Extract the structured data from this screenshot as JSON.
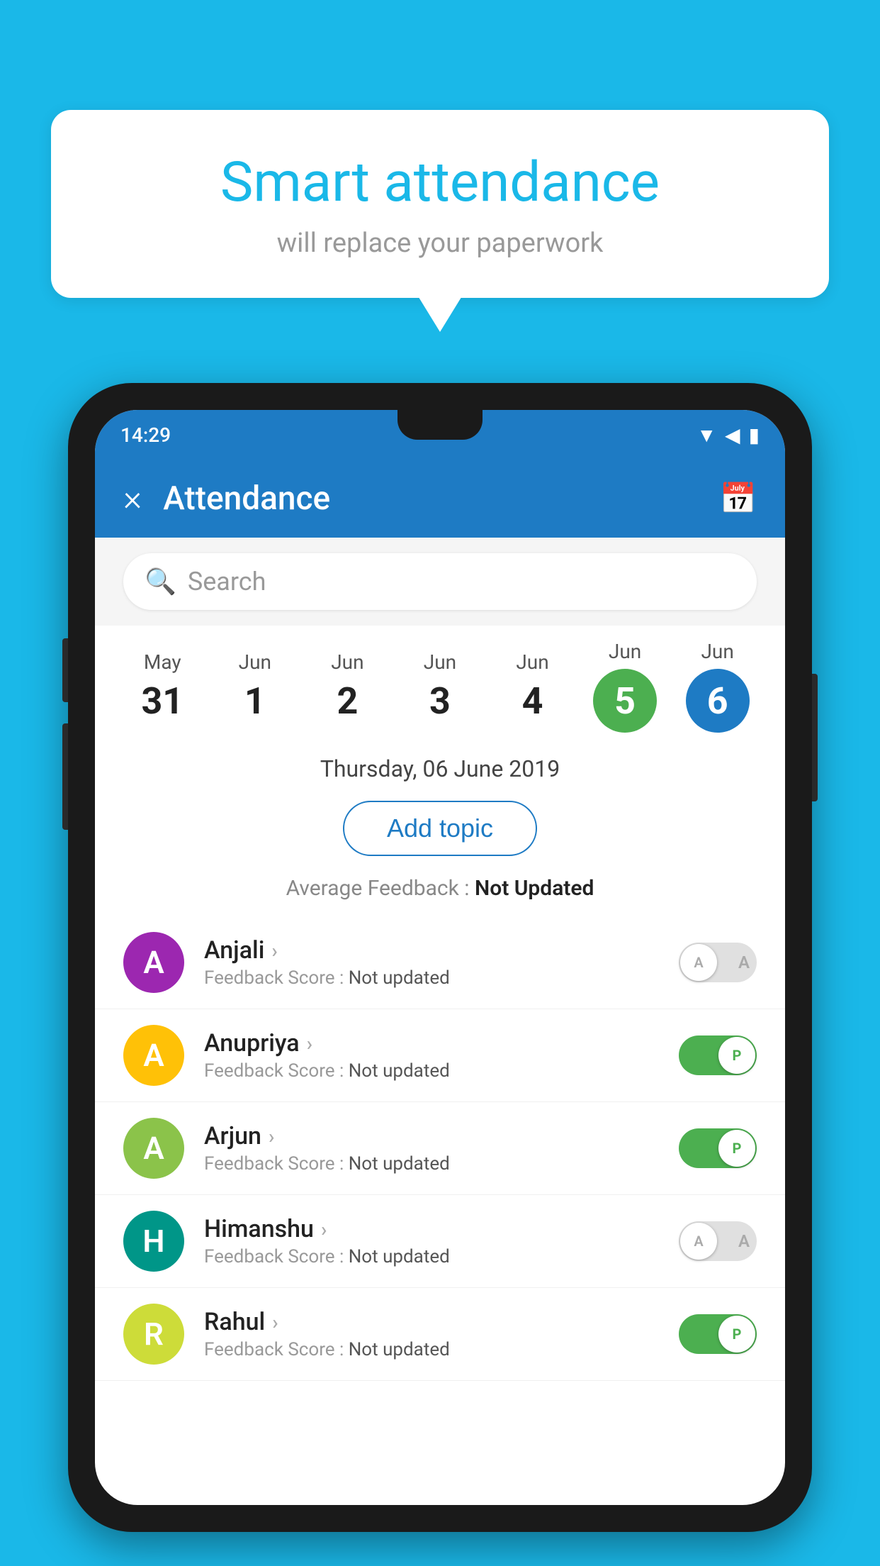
{
  "background_color": "#1ab8e8",
  "speech_bubble": {
    "title": "Smart attendance",
    "subtitle": "will replace your paperwork"
  },
  "status_bar": {
    "time": "14:29",
    "icons": [
      "wifi",
      "signal",
      "battery"
    ]
  },
  "app_bar": {
    "close_label": "×",
    "title": "Attendance",
    "calendar_icon": "📅"
  },
  "search": {
    "placeholder": "Search"
  },
  "calendar": {
    "days": [
      {
        "month": "May",
        "date": "31",
        "selected": false
      },
      {
        "month": "Jun",
        "date": "1",
        "selected": false
      },
      {
        "month": "Jun",
        "date": "2",
        "selected": false
      },
      {
        "month": "Jun",
        "date": "3",
        "selected": false
      },
      {
        "month": "Jun",
        "date": "4",
        "selected": false
      },
      {
        "month": "Jun",
        "date": "5",
        "selected": "green"
      },
      {
        "month": "Jun",
        "date": "6",
        "selected": "blue"
      }
    ]
  },
  "selected_date": "Thursday, 06 June 2019",
  "add_topic_label": "Add topic",
  "avg_feedback": {
    "label": "Average Feedback : ",
    "value": "Not Updated"
  },
  "students": [
    {
      "name": "Anjali",
      "avatar_letter": "A",
      "avatar_color": "purple",
      "feedback_label": "Feedback Score : ",
      "feedback_value": "Not updated",
      "toggle": "off",
      "toggle_letter": "A"
    },
    {
      "name": "Anupriya",
      "avatar_letter": "A",
      "avatar_color": "yellow",
      "feedback_label": "Feedback Score : ",
      "feedback_value": "Not updated",
      "toggle": "on",
      "toggle_letter": "P"
    },
    {
      "name": "Arjun",
      "avatar_letter": "A",
      "avatar_color": "green",
      "feedback_label": "Feedback Score : ",
      "feedback_value": "Not updated",
      "toggle": "on",
      "toggle_letter": "P"
    },
    {
      "name": "Himanshu",
      "avatar_letter": "H",
      "avatar_color": "teal",
      "feedback_label": "Feedback Score : ",
      "feedback_value": "Not updated",
      "toggle": "off",
      "toggle_letter": "A"
    },
    {
      "name": "Rahul",
      "avatar_letter": "R",
      "avatar_color": "lime",
      "feedback_label": "Feedback Score : ",
      "feedback_value": "Not updated",
      "toggle": "on",
      "toggle_letter": "P"
    }
  ]
}
